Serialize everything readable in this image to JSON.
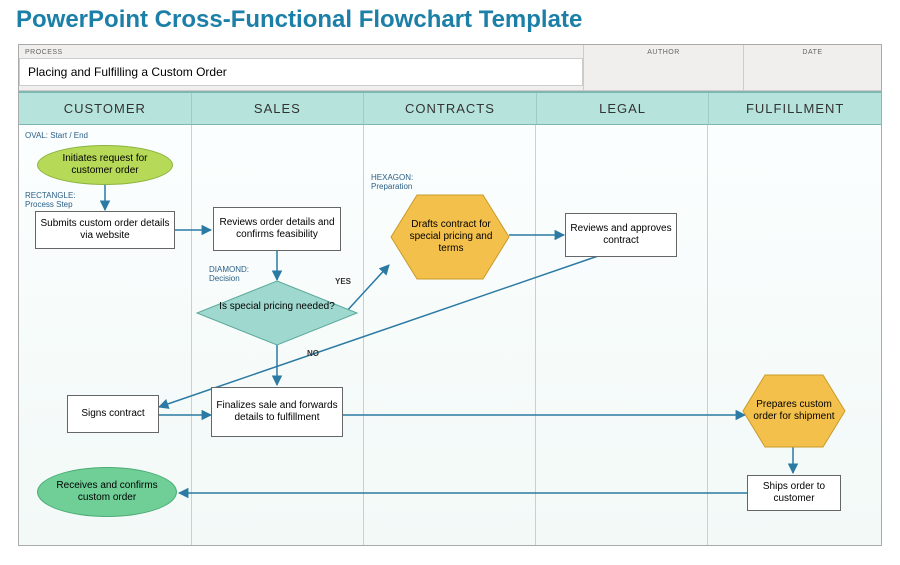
{
  "title": "PowerPoint Cross-Functional Flowchart Template",
  "meta": {
    "process_label": "PROCESS",
    "process_value": "Placing and Fulfilling a Custom Order",
    "author_label": "AUTHOR",
    "author_value": "",
    "date_label": "DATE",
    "date_value": ""
  },
  "lanes": [
    "CUSTOMER",
    "SALES",
    "CONTRACTS",
    "LEGAL",
    "FULFILLMENT"
  ],
  "hints": {
    "oval": "OVAL:  Start / End",
    "rect": "RECTANGLE:\nProcess Step",
    "hex": "HEXAGON:\nPreparation",
    "diamond": "DIAMOND:\nDecision"
  },
  "nodes": {
    "initiate": "Initiates request for customer order",
    "submit": "Submits custom order details via website",
    "review_order": "Reviews order details and confirms feasibility",
    "decision": "Is special pricing needed?",
    "yes": "YES",
    "no": "NO",
    "draft_contract": "Drafts contract for special pricing and terms",
    "review_approve": "Reviews and approves contract",
    "signs": "Signs contract",
    "finalize": "Finalizes sale and forwards details to fulfillment",
    "prepare": "Prepares custom order for shipment",
    "ships": "Ships order to customer",
    "receives": "Receives and confirms custom order"
  },
  "chart_data": {
    "type": "flowchart-swimlane",
    "title": "Placing and Fulfilling a Custom Order",
    "lanes": [
      "CUSTOMER",
      "SALES",
      "CONTRACTS",
      "LEGAL",
      "FULFILLMENT"
    ],
    "shape_legend": {
      "oval": "Start / End",
      "rectangle": "Process Step",
      "hexagon": "Preparation",
      "diamond": "Decision"
    },
    "nodes": [
      {
        "id": "initiate",
        "lane": "CUSTOMER",
        "shape": "oval",
        "label": "Initiates request for customer order"
      },
      {
        "id": "submit",
        "lane": "CUSTOMER",
        "shape": "rectangle",
        "label": "Submits custom order details via website"
      },
      {
        "id": "review_order",
        "lane": "SALES",
        "shape": "rectangle",
        "label": "Reviews order details and confirms feasibility"
      },
      {
        "id": "decision",
        "lane": "SALES",
        "shape": "diamond",
        "label": "Is special pricing needed?"
      },
      {
        "id": "draft_contract",
        "lane": "CONTRACTS",
        "shape": "hexagon",
        "label": "Drafts contract for special pricing and terms"
      },
      {
        "id": "review_approve",
        "lane": "LEGAL",
        "shape": "rectangle",
        "label": "Reviews and approves contract"
      },
      {
        "id": "signs",
        "lane": "CUSTOMER",
        "shape": "rectangle",
        "label": "Signs contract"
      },
      {
        "id": "finalize",
        "lane": "SALES",
        "shape": "rectangle",
        "label": "Finalizes sale and forwards details to fulfillment"
      },
      {
        "id": "prepare",
        "lane": "FULFILLMENT",
        "shape": "hexagon",
        "label": "Prepares custom order for shipment"
      },
      {
        "id": "ships",
        "lane": "FULFILLMENT",
        "shape": "rectangle",
        "label": "Ships order to customer"
      },
      {
        "id": "receives",
        "lane": "CUSTOMER",
        "shape": "oval",
        "label": "Receives and confirms custom order"
      }
    ],
    "edges": [
      {
        "from": "initiate",
        "to": "submit"
      },
      {
        "from": "submit",
        "to": "review_order"
      },
      {
        "from": "review_order",
        "to": "decision"
      },
      {
        "from": "decision",
        "to": "draft_contract",
        "label": "YES"
      },
      {
        "from": "decision",
        "to": "finalize",
        "label": "NO"
      },
      {
        "from": "draft_contract",
        "to": "review_approve"
      },
      {
        "from": "review_approve",
        "to": "signs"
      },
      {
        "from": "signs",
        "to": "finalize"
      },
      {
        "from": "finalize",
        "to": "prepare"
      },
      {
        "from": "prepare",
        "to": "ships"
      },
      {
        "from": "ships",
        "to": "receives"
      }
    ]
  }
}
